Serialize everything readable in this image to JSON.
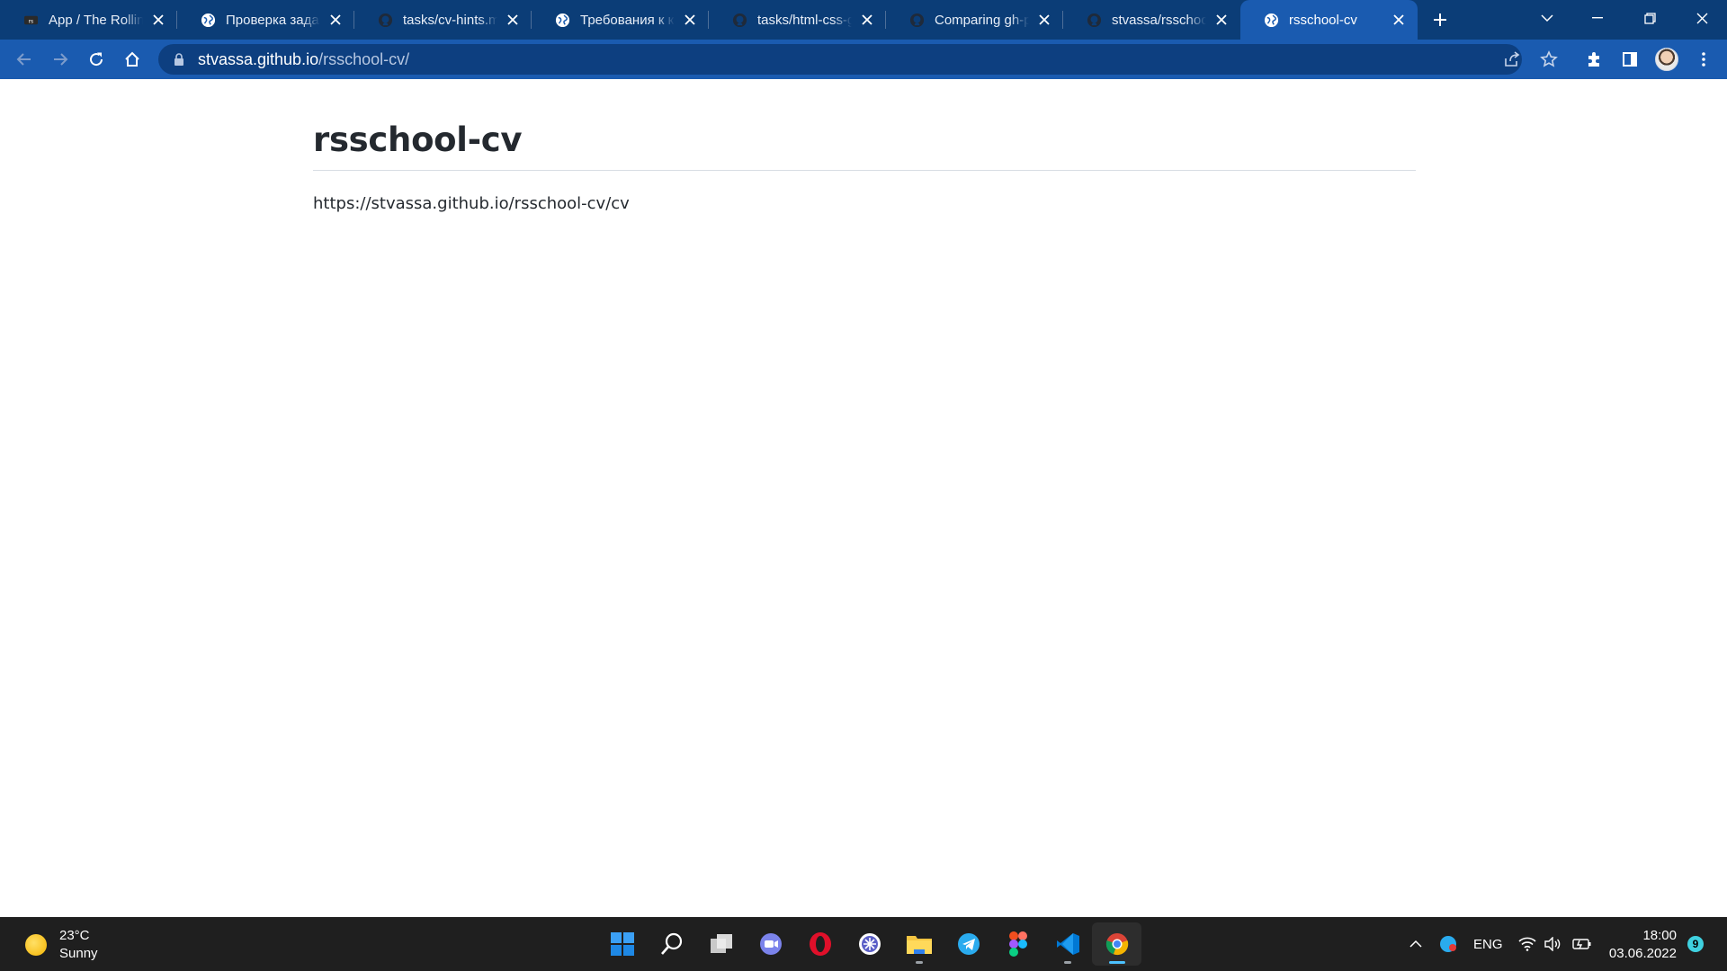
{
  "browser": {
    "tabs": [
      {
        "title": "App / The Rolling Scopes",
        "favicon": "rolling-scopes-icon",
        "active": false
      },
      {
        "title": "Проверка задания",
        "favicon": "globe-icon",
        "active": false
      },
      {
        "title": "tasks/cv-hints.md",
        "favicon": "github-icon",
        "active": false
      },
      {
        "title": "Требования к контенту",
        "favicon": "globe-icon",
        "active": false
      },
      {
        "title": "tasks/html-css-git",
        "favicon": "github-icon",
        "active": false
      },
      {
        "title": "Comparing gh-pages",
        "favicon": "github-icon",
        "active": false
      },
      {
        "title": "stvassa/rsschool-cv",
        "favicon": "github-icon",
        "active": false
      },
      {
        "title": "rsschool-cv",
        "favicon": "globe-icon",
        "active": true
      }
    ],
    "address": {
      "host": "stvassa.github.io",
      "path": "/rsschool-cv/"
    }
  },
  "page": {
    "title": "rsschool-cv",
    "link_text": "https://stvassa.github.io/rsschool-cv/cv"
  },
  "taskbar": {
    "weather": {
      "temp": "23°C",
      "condition": "Sunny"
    },
    "apps": [
      "start-icon",
      "search-icon",
      "task-view-icon",
      "teams-chat-icon",
      "opera-icon",
      "app-icon",
      "file-explorer-icon",
      "telegram-icon",
      "figma-icon",
      "vscode-icon",
      "chrome-icon"
    ],
    "language": "ENG",
    "time": "18:00",
    "date": "03.06.2022",
    "notifications": "9"
  },
  "colors": {
    "tabstrip": "#0b3d77",
    "toolbar": "#1a5bb0",
    "taskbar": "#1f1f1f",
    "text": "#24292f"
  }
}
